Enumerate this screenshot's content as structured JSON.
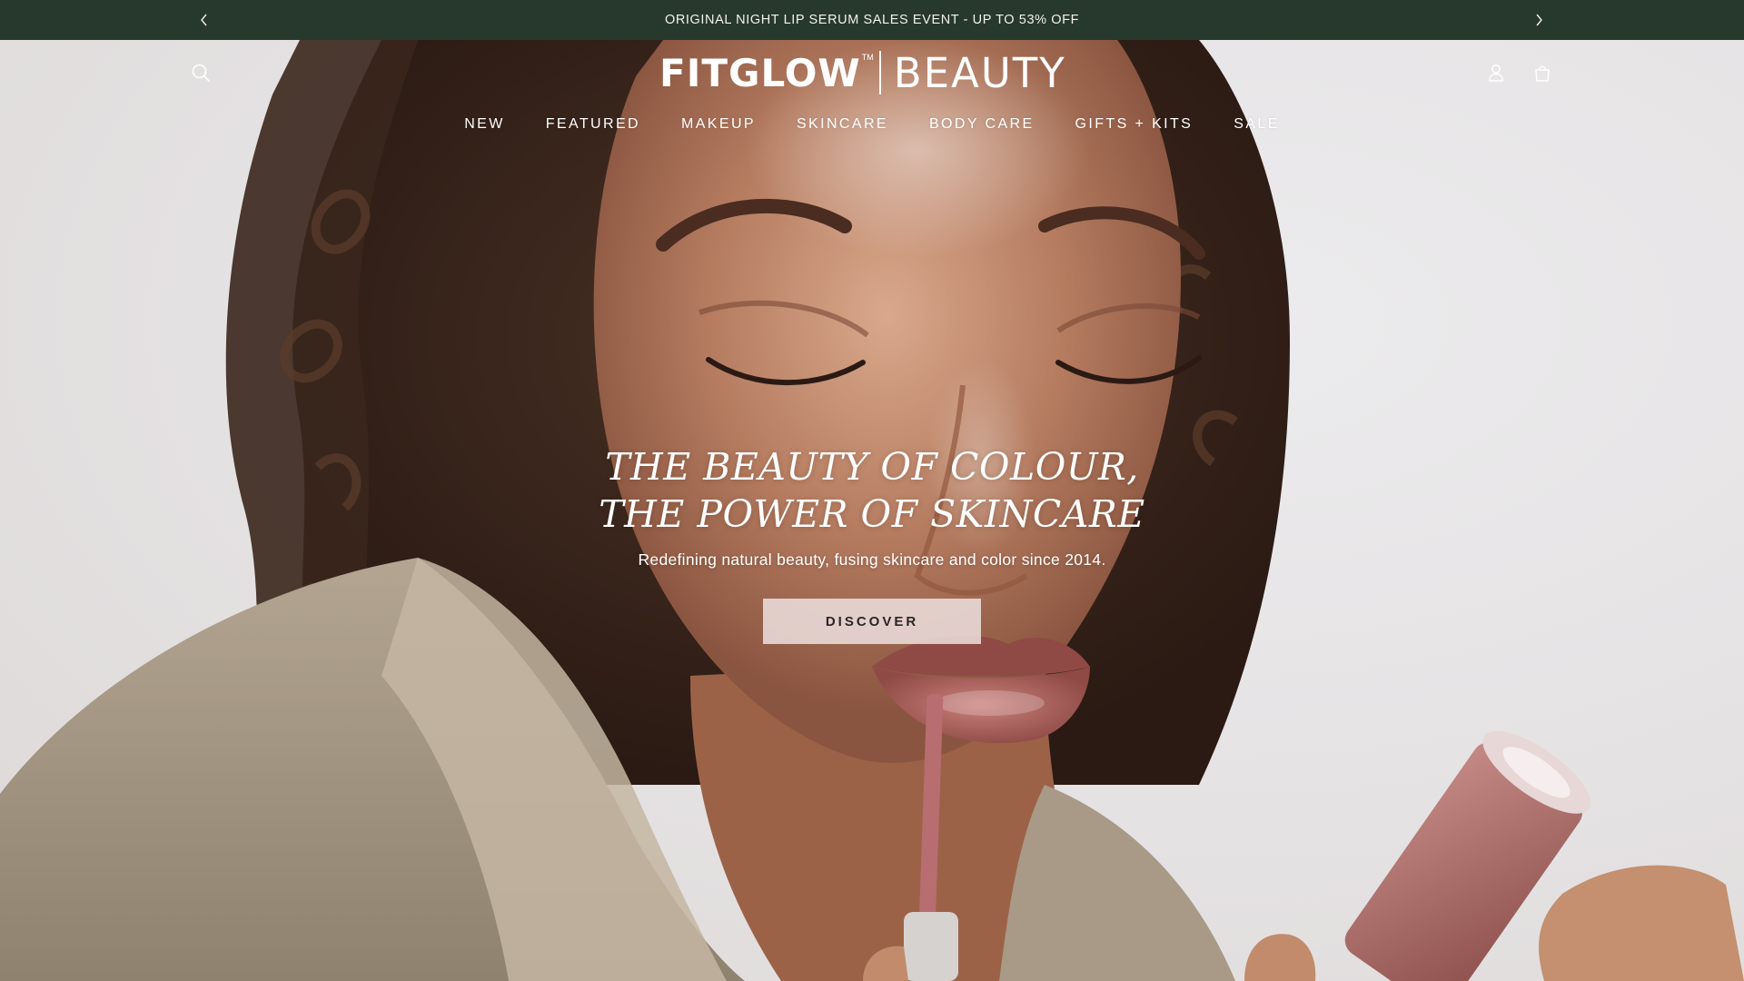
{
  "announcement": {
    "text": "ORIGINAL NIGHT LIP SERUM SALES EVENT - UP TO 53% OFF",
    "prev_icon": "chevron-left-icon",
    "next_icon": "chevron-right-icon"
  },
  "header": {
    "logo_main": "FITGLOW",
    "logo_tm": "TM",
    "logo_sub": "BEAUTY",
    "icons": [
      "search-icon",
      "account-icon",
      "cart-icon"
    ]
  },
  "nav": {
    "items": [
      "NEW",
      "FEATURED",
      "MAKEUP",
      "SKINCARE",
      "BODY CARE",
      "GIFTS + KITS",
      "SALE"
    ]
  },
  "hero": {
    "headline_line1": "THE BEAUTY OF COLOUR,",
    "headline_line2": "THE POWER OF SKINCARE",
    "subtitle": "Redefining natural beauty, fusing skincare and color since 2014.",
    "cta_label": "DISCOVER"
  },
  "colors": {
    "announcement_bg": "#26392c",
    "header_text": "#ffffff",
    "cta_bg": "#ece0de"
  }
}
